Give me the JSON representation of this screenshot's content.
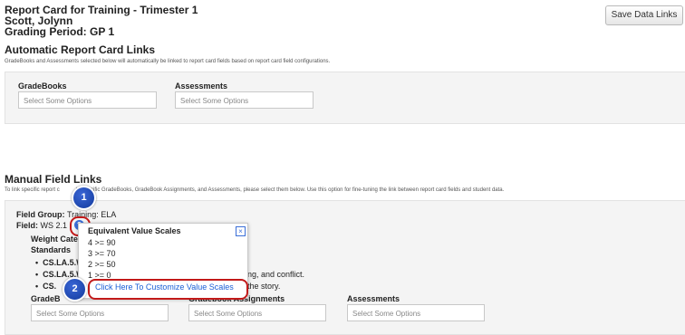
{
  "header": {
    "title": "Report Card for Training - Trimester 1",
    "student": "Scott, Jolynn",
    "grading_period": "Grading Period: GP 1",
    "save_button": "Save Data Links"
  },
  "auto_links": {
    "title": "Automatic Report Card Links",
    "description": "GradeBooks and Assessments selected below will automatically be linked to report card fields based on report card field configurations.",
    "gradebooks_label": "GradeBooks",
    "gradebooks_placeholder": "Select Some Options",
    "assessments_label": "Assessments",
    "assessments_placeholder": "Select Some Options"
  },
  "manual_links": {
    "title": "Manual Field Links",
    "description_before": "To link specific report c",
    "description_after": "to specific GradeBooks, GradeBook Assignments, and Assessments, please select them below. Use this option for fine-tuning the link between report card fields and student data.",
    "field_group_label": "Field Group:",
    "field_group_value": "Training: ELA",
    "field_label": "Field:",
    "field_value": "WS 2.1",
    "weight_category": "Weight Categ",
    "standards_label": "Standards",
    "standards": [
      {
        "code": "CS.LA.5.W",
        "text": ""
      },
      {
        "code": "CS.LA.5.W",
        "text": "ng, and conflict."
      },
      {
        "code": "CS.",
        "text": "the story."
      }
    ],
    "gradebooks_label": "GradeB",
    "gradebook_assignments_label": "Gradebook Assignments",
    "assessments_label": "Assessments",
    "gradebooks_placeholder": "Select Some Options",
    "assignments_placeholder": "Select Some Options",
    "assessments_placeholder": "Select Some Options"
  },
  "popup": {
    "title": "Equivalent Value Scales",
    "scales": [
      "4 >= 90",
      "3 >= 70",
      "2 >= 50",
      "1 >= 0"
    ],
    "link": "Click Here To Customize Value Scales"
  },
  "callouts": {
    "first": "1",
    "second": "2"
  },
  "colors": {
    "callout_blue": "#1f4fbf",
    "highlight_red": "#c21a1a",
    "link_blue": "#1a5fd6",
    "panel_bg": "#f4f4f4"
  }
}
